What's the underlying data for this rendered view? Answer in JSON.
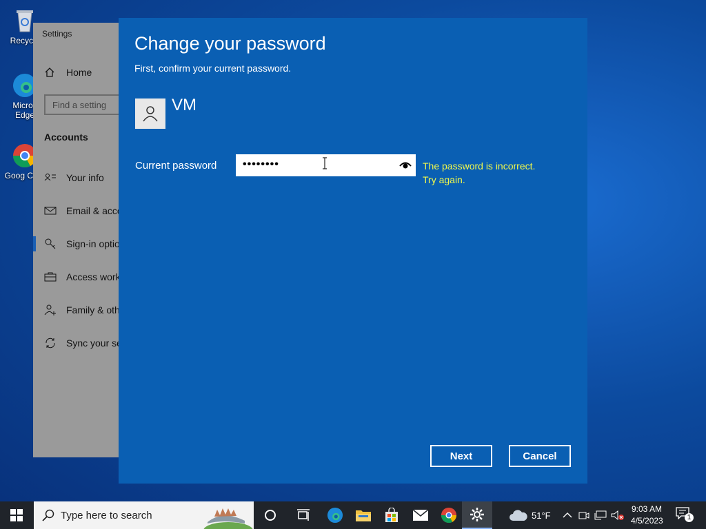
{
  "desktop": {
    "icons": [
      {
        "label": "Recycle",
        "name": "recycle-bin"
      },
      {
        "label": "Micros Edge",
        "name": "edge"
      },
      {
        "label": "Goog Chro",
        "name": "chrome"
      }
    ]
  },
  "settings": {
    "title": "Settings",
    "home": "Home",
    "search_placeholder": "Find a setting",
    "section": "Accounts",
    "nav": [
      "Your info",
      "Email & acco",
      "Sign-in optio",
      "Access work",
      "Family & oth",
      "Sync your se"
    ]
  },
  "dialog": {
    "title": "Change your password",
    "subtitle": "First, confirm your current password.",
    "username": "VM",
    "password_label": "Current password",
    "password_value": "••••••••",
    "error_line1": "The password is incorrect.",
    "error_line2": "Try again.",
    "next_label": "Next",
    "cancel_label": "Cancel"
  },
  "taskbar": {
    "search_placeholder": "Type here to search",
    "weather": "51°F",
    "time": "9:03 AM",
    "date": "4/5/2023",
    "notification_count": "1"
  },
  "colors": {
    "dialog_bg": "#0a5fb3",
    "error_text": "#f1f84b",
    "taskbar_bg": "#20242a"
  }
}
